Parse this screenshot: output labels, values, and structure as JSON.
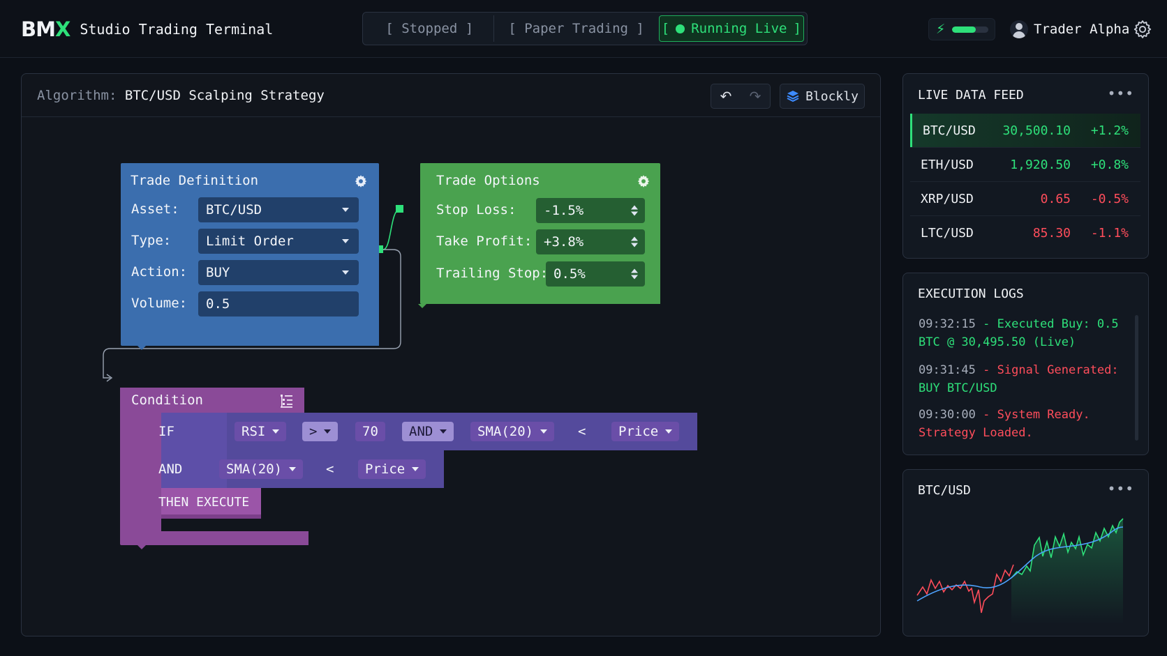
{
  "header": {
    "logo_white": "BM",
    "logo_green": "X",
    "app_title": "Studio Trading Terminal",
    "modes": {
      "stopped": "[ Stopped ]",
      "paper": "[ Paper Trading ]",
      "live_open": "[",
      "live_label": "Running Live",
      "live_close": "]"
    },
    "power_level": 0.65,
    "user_name": "Trader Alpha"
  },
  "workspace": {
    "algorithm_key": "Algorithm:",
    "algorithm_name": "BTC/USD Scalping Strategy",
    "blockly_label": "Blockly"
  },
  "trade_definition": {
    "title": "Trade Definition",
    "fields": [
      {
        "label": "Asset:",
        "value": "BTC/USD"
      },
      {
        "label": "Type:",
        "value": "Limit Order"
      },
      {
        "label": "Action:",
        "value": "BUY"
      },
      {
        "label": "Volume:",
        "value": "0.5"
      }
    ]
  },
  "trade_options": {
    "title": "Trade Options",
    "fields": [
      {
        "label": "Stop Loss:",
        "value": "-1.5%"
      },
      {
        "label": "Take Profit:",
        "value": "+3.8%"
      },
      {
        "label": "Trailing Stop:",
        "value": "0.5%"
      }
    ]
  },
  "condition": {
    "title": "Condition",
    "if_label": "IF",
    "and_label": "AND",
    "then_label": "THEN EXECUTE",
    "row1": {
      "indicator": "RSI",
      "op": ">",
      "value": "70",
      "logic": "AND",
      "indicator2": "SMA(20)",
      "cmp": "<",
      "target": "Price"
    },
    "row2": {
      "indicator": "SMA(20)",
      "cmp": "<",
      "target": "Price"
    }
  },
  "live_feed": {
    "title": "LIVE DATA FEED",
    "rows": [
      {
        "pair": "BTC/USD",
        "price": "30,500.10",
        "change": "+1.2%",
        "direction": "up"
      },
      {
        "pair": "ETH/USD",
        "price": "1,920.50",
        "change": "+0.8%",
        "direction": "up"
      },
      {
        "pair": "XRP/USD",
        "price": "0.65",
        "change": "-0.5%",
        "direction": "down"
      },
      {
        "pair": "LTC/USD",
        "price": "85.30",
        "change": "-1.1%",
        "direction": "down"
      }
    ]
  },
  "execution_logs": {
    "title": "EXECUTION LOGS",
    "entries": [
      {
        "time": "09:32:15",
        "dash": "-",
        "message": "Executed Buy: 0.5 BTC @ 30,495.50 (Live)",
        "color": "#2ee07a"
      },
      {
        "time": "09:31:45",
        "dash": "-",
        "message": "Signal Generated:",
        "message2": "BUY BTC/USD",
        "color": "#ff4d5b",
        "color2": "#2ee07a"
      },
      {
        "time": "09:30:00",
        "dash": "-",
        "message": "System Ready. Strategy Loaded.",
        "color": "#ff4d5b"
      }
    ]
  },
  "mini_chart": {
    "title": "BTC/USD"
  },
  "colors": {
    "accent_green": "#2ee07a",
    "loss_red": "#ff4d5b",
    "block_blue": "#3b6eae",
    "block_green": "#4aa24f",
    "block_purple": "#8a4a98",
    "block_indigo": "#544a9c"
  }
}
